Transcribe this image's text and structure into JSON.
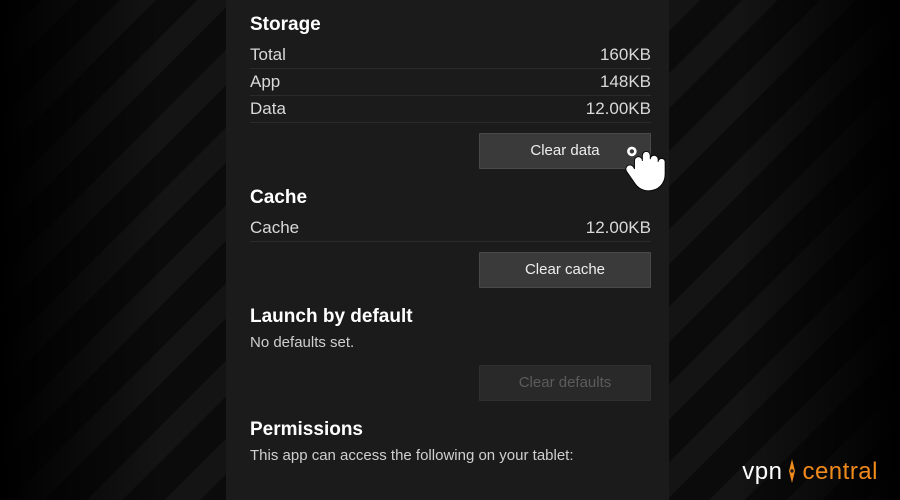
{
  "storage": {
    "title": "Storage",
    "rows": {
      "total": {
        "label": "Total",
        "value": "160KB"
      },
      "app": {
        "label": "App",
        "value": "148KB"
      },
      "data": {
        "label": "Data",
        "value": "12.00KB"
      }
    },
    "clear_data_label": "Clear data"
  },
  "cache": {
    "title": "Cache",
    "row": {
      "label": "Cache",
      "value": "12.00KB"
    },
    "clear_cache_label": "Clear cache"
  },
  "launch": {
    "title": "Launch by default",
    "subtext": "No defaults set.",
    "clear_defaults_label": "Clear defaults"
  },
  "permissions": {
    "title": "Permissions",
    "subtext": "This app can access the following on your tablet:"
  },
  "watermark": {
    "left": "vpn",
    "right": "central"
  }
}
